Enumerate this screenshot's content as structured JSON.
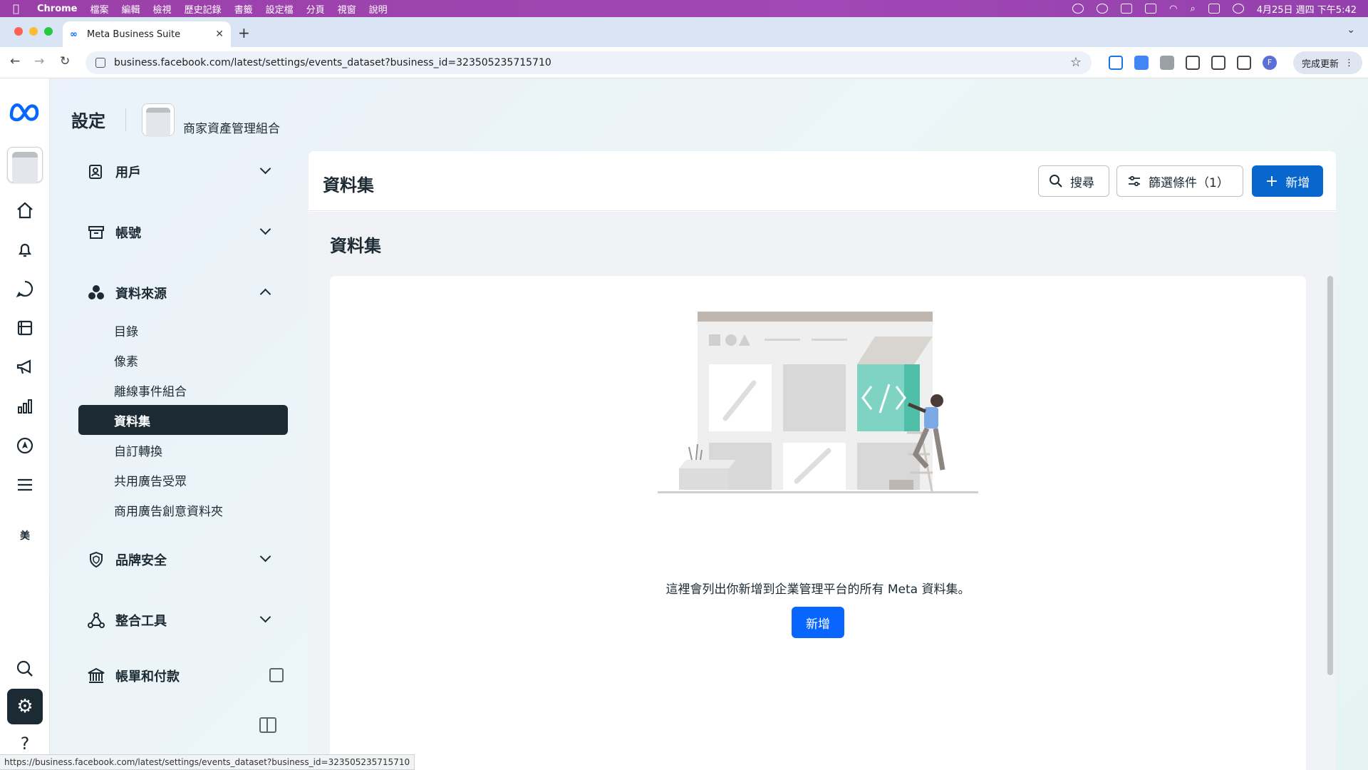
{
  "menubar": {
    "app": "Chrome",
    "items": [
      "檔案",
      "編輯",
      "檢視",
      "歷史記錄",
      "書籤",
      "設定檔",
      "分頁",
      "視窗",
      "說明"
    ],
    "clock": "4月25日 週四 下午5:42"
  },
  "browser": {
    "tab_title": "Meta Business Suite",
    "url": "business.facebook.com/latest/settings/events_dataset?business_id=323505235715710",
    "update_label": "完成更新",
    "profile_initial": "F"
  },
  "header": {
    "title": "設定",
    "business_name": "商家資產管理組合"
  },
  "settings_nav": {
    "users": "用戶",
    "accounts": "帳號",
    "data_sources": "資料來源",
    "data_sources_items": [
      "目錄",
      "像素",
      "離線事件組合",
      "資料集",
      "自訂轉換",
      "共用廣告受眾",
      "商用廣告創意資料夾"
    ],
    "brand_safety": "品牌安全",
    "integrations": "整合工具",
    "billing": "帳單和付款"
  },
  "main": {
    "title": "資料集",
    "search_label": "搜尋",
    "filter_label": "篩選條件（1）",
    "add_label": "新增",
    "section_title": "資料集",
    "empty_text": "這裡會列出你新增到企業管理平台的所有 Meta 資料集。",
    "empty_add_label": "新增"
  },
  "status_bar": {
    "url": "https://business.facebook.com/latest/settings/events_dataset?business_id=323505235715710"
  },
  "colors": {
    "primary": "#0866ff",
    "dark": "#1c2b33",
    "menubar": "#a048b5"
  }
}
